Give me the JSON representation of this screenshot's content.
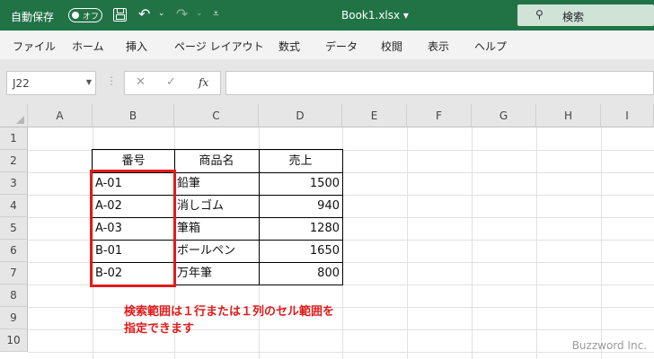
{
  "titlebar": {
    "autosave_label": "自動保存",
    "autosave_state": "オフ",
    "file_title": "Book1.xlsx ▾",
    "search_label": "検索"
  },
  "menu": [
    "ファイル",
    "ホーム",
    "挿入",
    "ページ レイアウト",
    "数式",
    "データ",
    "校閲",
    "表示",
    "ヘルプ"
  ],
  "formula_bar": {
    "name_box": "J22",
    "fx": "fx",
    "cancel": "✕",
    "enter": "✓"
  },
  "columns": [
    "A",
    "B",
    "C",
    "D",
    "E",
    "F",
    "G",
    "H",
    "I"
  ],
  "rows": [
    "1",
    "2",
    "3",
    "4",
    "5",
    "6",
    "7",
    "8",
    "9",
    "10"
  ],
  "table": {
    "headers": [
      "番号",
      "商品名",
      "売上"
    ],
    "rows": [
      [
        "A-01",
        "鉛筆",
        "1500"
      ],
      [
        "A-02",
        "消しゴム",
        "940"
      ],
      [
        "A-03",
        "筆箱",
        "1280"
      ],
      [
        "B-01",
        "ボールペン",
        "1650"
      ],
      [
        "B-02",
        "万年筆",
        "800"
      ]
    ]
  },
  "annotation": {
    "line1": "検索範囲は１行または１列のセル範囲を",
    "line2": "指定できます"
  },
  "watermark": "Buzzword Inc.",
  "colors": {
    "excel_green": "#217346",
    "highlight_red": "#e01b1b"
  }
}
